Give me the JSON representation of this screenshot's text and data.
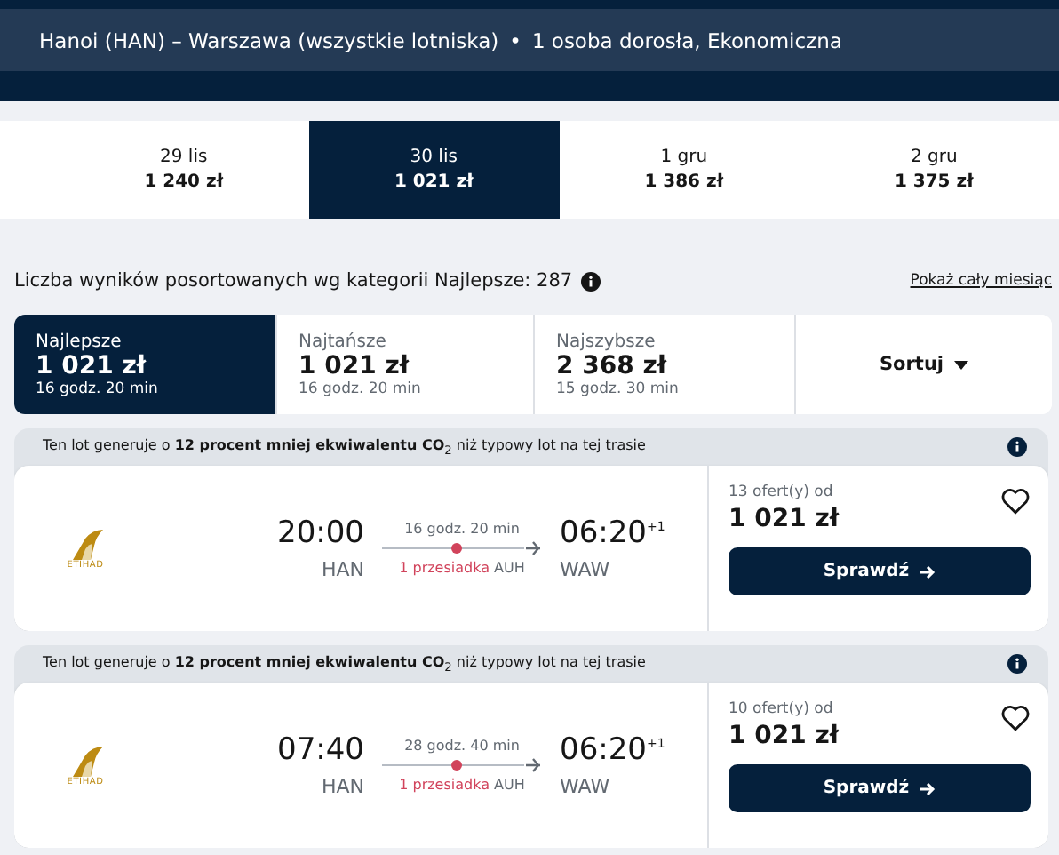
{
  "search_summary": {
    "route": "Hanoi (HAN) – Warszawa (wszystkie lotniska)",
    "separator": "•",
    "passengers": "1 osoba dorosła, Ekonomiczna"
  },
  "date_tabs": [
    {
      "date": "29 lis",
      "price": "1 240 zł",
      "selected": false
    },
    {
      "date": "30 lis",
      "price": "1 021 zł",
      "selected": true
    },
    {
      "date": "1 gru",
      "price": "1 386 zł",
      "selected": false
    },
    {
      "date": "2 gru",
      "price": "1 375 zł",
      "selected": false
    }
  ],
  "results_info": {
    "text": "Liczba wyników posortowanych wg kategorii Najlepsze: 287",
    "link": "Pokaż cały miesiąc"
  },
  "sort_tabs": [
    {
      "kind": "category",
      "label": "Najlepsze",
      "price": "1 021 zł",
      "duration": "16 godz. 20 min",
      "selected": true
    },
    {
      "kind": "category",
      "label": "Najtańsze",
      "price": "1 021 zł",
      "duration": "16 godz. 20 min",
      "selected": false
    },
    {
      "kind": "category",
      "label": "Najszybsze",
      "price": "2 368 zł",
      "duration": "15 godz. 30 min",
      "selected": false
    },
    {
      "kind": "dropdown",
      "label": "Sortuj",
      "selected": false
    }
  ],
  "flights": [
    {
      "eco_note": "Ten lot generuje o **12 procent mniej ekwiwalentu CO**$_{2}$ niż typowy lot na tej trasie",
      "airline_logo": "ETIHAD",
      "depart_time": "20:00",
      "depart_airport": "HAN",
      "duration": "16 godz. 20 min",
      "stops": "1 przesiadka",
      "stop_airport": "AUH",
      "arrive_time": "06:20",
      "day_offset": "+1",
      "arrive_airport": "WAW",
      "offers": "13 ofert(y) od",
      "price": "1 021 zł",
      "button": "Sprawdź",
      "favorite": false
    },
    {
      "eco_note": "Ten lot generuje o **12 procent mniej ekwiwalentu CO**$_{2}$ niż typowy lot na tej trasie",
      "airline_logo": "ETIHAD",
      "depart_time": "07:40",
      "depart_airport": "HAN",
      "duration": "28 godz. 40 min",
      "stops": "1 przesiadka",
      "stop_airport": "AUH",
      "arrive_time": "06:20",
      "day_offset": "+1",
      "arrive_airport": "WAW",
      "offers": "10 ofert(y) od",
      "price": "1 021 zł",
      "button": "Sprawdź",
      "favorite": false
    }
  ]
}
